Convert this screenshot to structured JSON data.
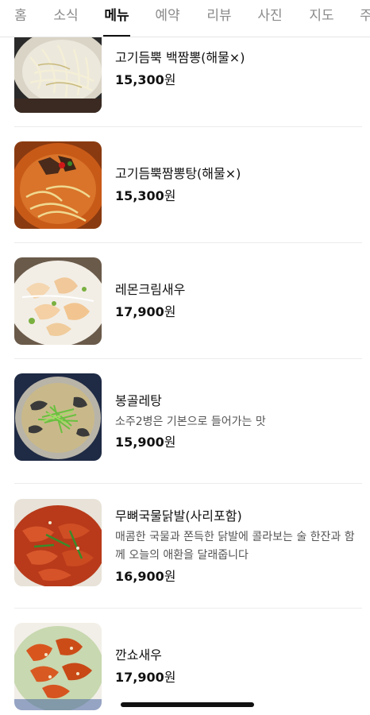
{
  "tabs": [
    {
      "label": "홈"
    },
    {
      "label": "소식"
    },
    {
      "label": "메뉴"
    },
    {
      "label": "예약"
    },
    {
      "label": "리뷰"
    },
    {
      "label": "사진"
    },
    {
      "label": "지도"
    },
    {
      "label": "주"
    }
  ],
  "active_tab": "메뉴",
  "menu": [
    {
      "name": "고기듬뿍 백짬뽕(해물×)",
      "price_number": "15,300",
      "price_unit": "원"
    },
    {
      "name": "고기듬뿍짬뽕탕(해물×)",
      "price_number": "15,300",
      "price_unit": "원"
    },
    {
      "name": "레몬크림새우",
      "price_number": "17,900",
      "price_unit": "원"
    },
    {
      "name": "봉골레탕",
      "description": "소주2병은 기본으로 들어가는 맛",
      "price_number": "15,900",
      "price_unit": "원"
    },
    {
      "name": "무뼈국물닭발(사리포함)",
      "description": "매콤한 국물과 쫀득한 닭발에 콜라보는 술 한잔과 함께 오늘의 애환을 달래줍니다",
      "price_number": "16,900",
      "price_unit": "원"
    },
    {
      "name": "깐쇼새우",
      "price_number": "17,900",
      "price_unit": "원"
    }
  ]
}
